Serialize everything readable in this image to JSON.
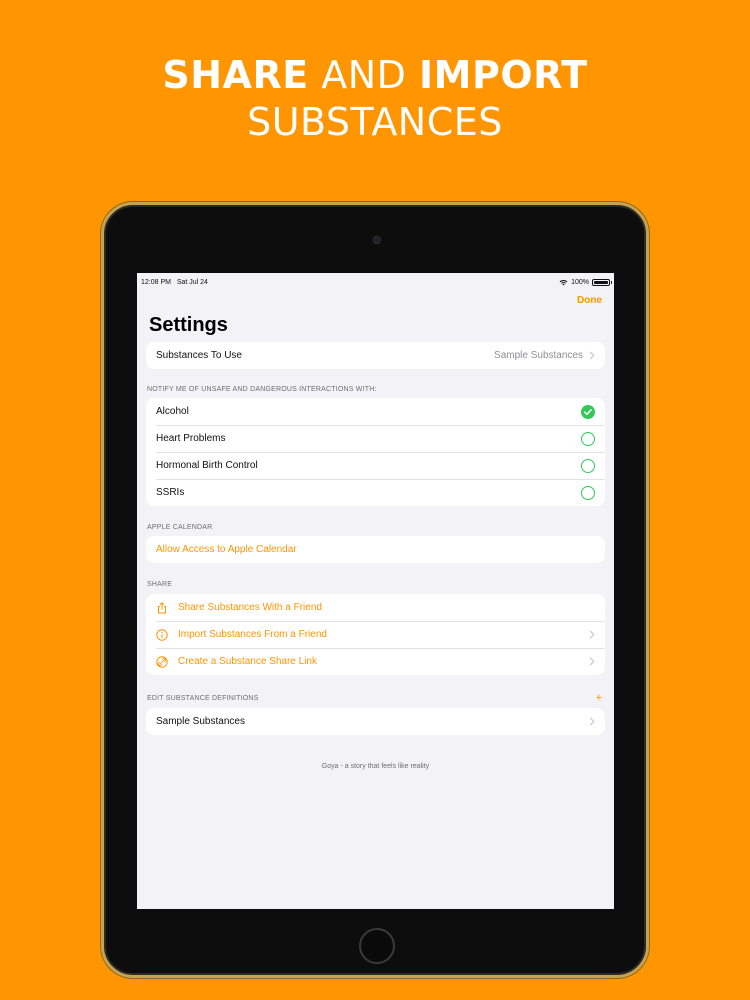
{
  "headline": {
    "line1_bold_a": "SHARE",
    "line1_normal": "AND",
    "line1_bold_b": "IMPORT",
    "line2": "SUBSTANCES"
  },
  "status_bar": {
    "time": "12:08 PM",
    "date": "Sat Jul 24",
    "battery": "100%"
  },
  "nav": {
    "done_label": "Done"
  },
  "page": {
    "title": "Settings"
  },
  "substances_to_use": {
    "label": "Substances To Use",
    "value": "Sample Substances"
  },
  "interactions": {
    "header": "NOTIFY ME OF UNSAFE AND DANGEROUS INTERACTIONS WITH:",
    "items": [
      {
        "label": "Alcohol",
        "checked": true
      },
      {
        "label": "Heart Problems",
        "checked": false
      },
      {
        "label": "Hormonal Birth Control",
        "checked": false
      },
      {
        "label": "SSRIs",
        "checked": false
      }
    ]
  },
  "calendar": {
    "header": "APPLE CALENDAR",
    "allow_label": "Allow Access to Apple Calendar"
  },
  "share": {
    "header": "SHARE",
    "items": [
      {
        "label": "Share Substances With a Friend",
        "icon": "share-icon"
      },
      {
        "label": "Import Substances From a Friend",
        "icon": "info-icon"
      },
      {
        "label": "Create a Substance Share Link",
        "icon": "link-icon"
      }
    ]
  },
  "definitions": {
    "header": "EDIT SUBSTANCE DEFINITIONS",
    "add_symbol": "+",
    "items": [
      {
        "label": "Sample Substances"
      }
    ]
  },
  "footer": {
    "text": "Goya - a story that feels like reality"
  },
  "colors": {
    "accent": "#FF9500",
    "check": "#34C759",
    "background": "#F2F2F7"
  }
}
